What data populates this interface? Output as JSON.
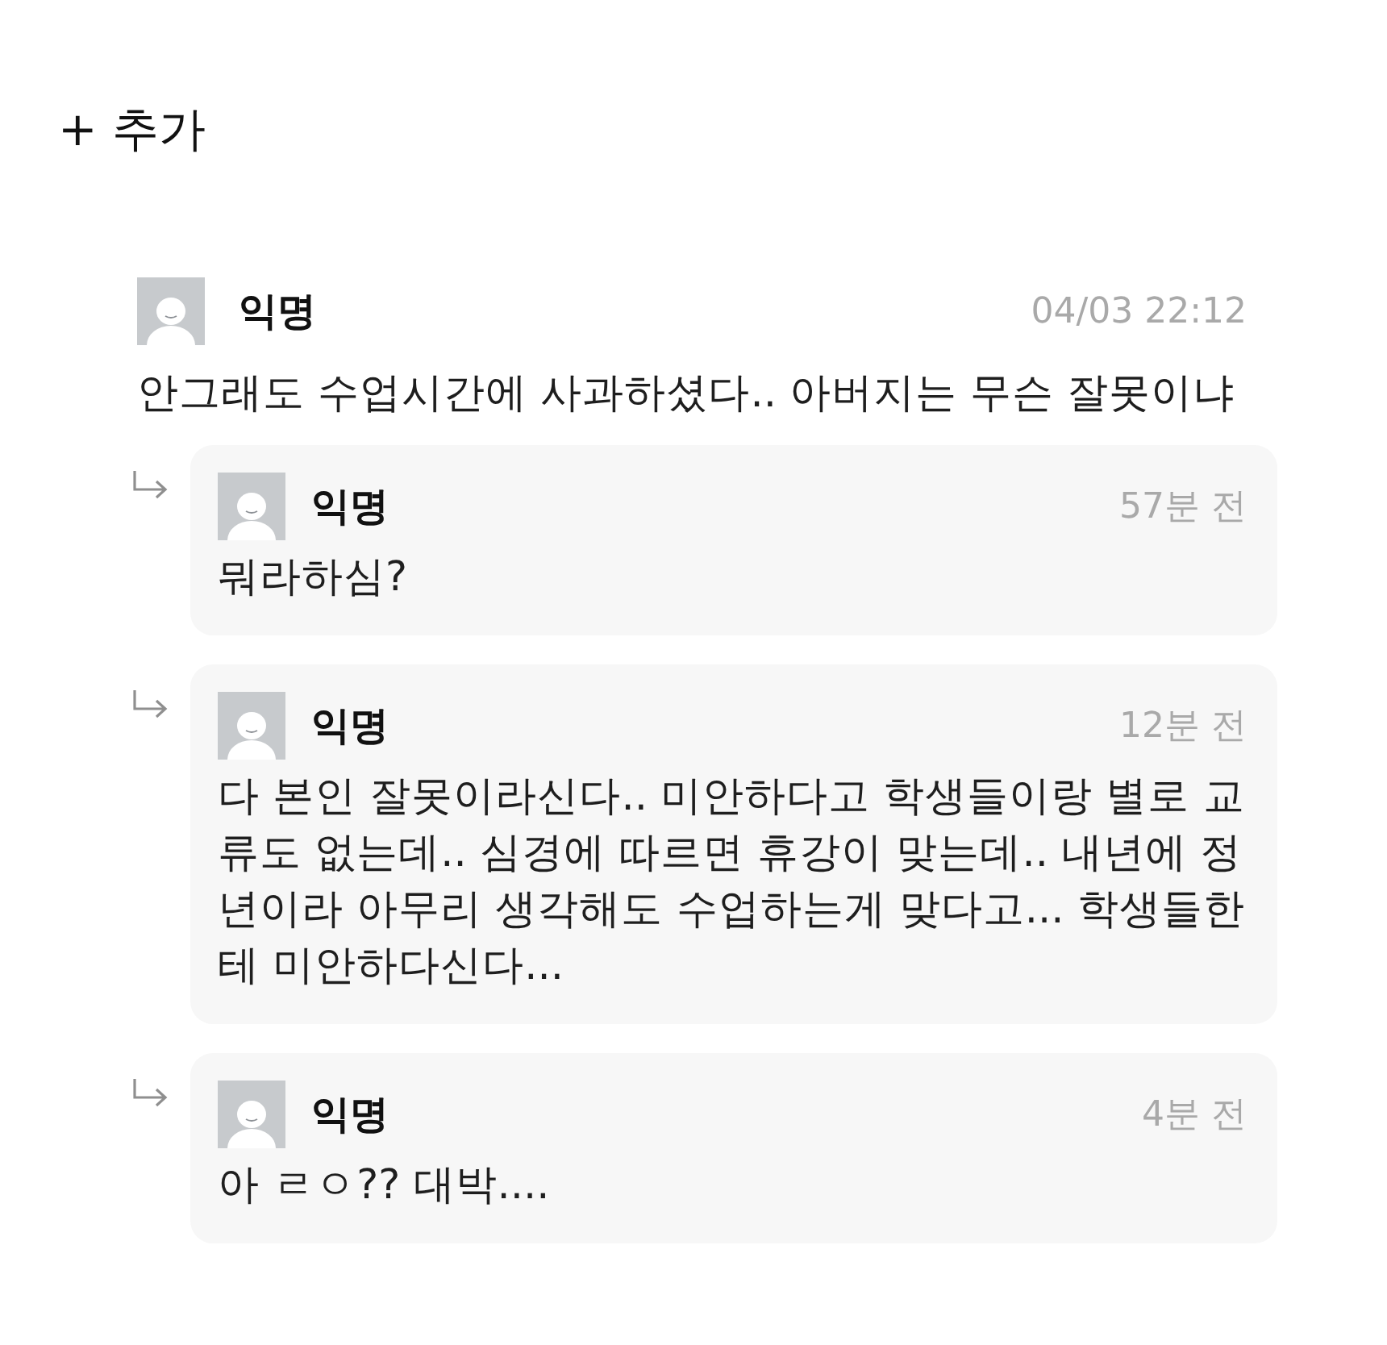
{
  "add_button": {
    "label": "+ 추가"
  },
  "comment": {
    "author": "익명",
    "time": "04/03 22:12",
    "text": "안그래도 수업시간에 사과하셨다.. 아버지는 무슨 잘못이냐"
  },
  "replies": [
    {
      "author": "익명",
      "time": "57분 전",
      "text": "뭐라하심?"
    },
    {
      "author": "익명",
      "time": "12분 전",
      "text": "다 본인 잘못이라신다.. 미안하다고 학생들이랑 별로 교류도 없는데.. 심경에 따르면 휴강이 맞는데.. 내년에 정년이라 아무리 생각해도 수업하는게 맞다고... 학생들한테 미안하다신다..."
    },
    {
      "author": "익명",
      "time": "4분 전",
      "text": "아 ㄹㅇ?? 대박...."
    }
  ]
}
